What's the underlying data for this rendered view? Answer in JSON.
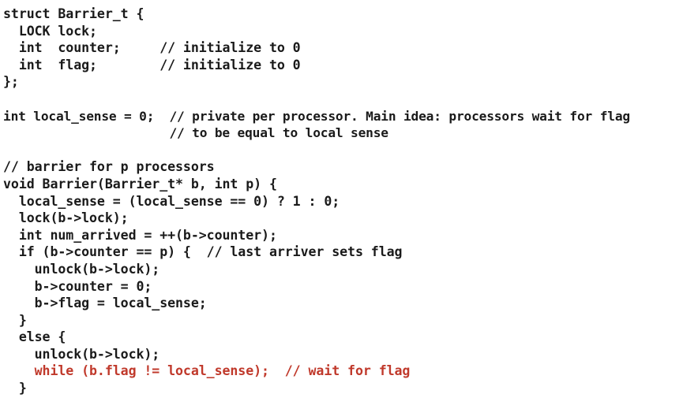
{
  "document": {
    "kind": "source-code-listing",
    "language": "C",
    "background_color": "#ffffff",
    "text_color": "#1a1a1a",
    "highlight_color": "#c0392b"
  },
  "code": {
    "lines": [
      {
        "id": "line-1",
        "text": "struct Barrier_t {",
        "color": "default"
      },
      {
        "id": "line-2",
        "text": "  LOCK lock;",
        "color": "default"
      },
      {
        "id": "line-3",
        "text": "  int  counter;     // initialize to 0",
        "color": "default"
      },
      {
        "id": "line-4",
        "text": "  int  flag;        // initialize to 0",
        "color": "default"
      },
      {
        "id": "line-5",
        "text": "};",
        "color": "default"
      },
      {
        "id": "line-6",
        "text": "",
        "color": "default"
      },
      {
        "id": "line-7",
        "text": "int local_sense = 0;  // private per processor. Main idea: processors wait for flag",
        "color": "default",
        "condensed": true
      },
      {
        "id": "line-8",
        "text": "                      // to be equal to local sense",
        "color": "default",
        "condensed": true
      },
      {
        "id": "line-9",
        "text": "",
        "color": "default"
      },
      {
        "id": "line-10",
        "text": "// barrier for p processors",
        "color": "default"
      },
      {
        "id": "line-11",
        "text": "void Barrier(Barrier_t* b, int p) {",
        "color": "default"
      },
      {
        "id": "line-12",
        "text": "  local_sense = (local_sense == 0) ? 1 : 0;",
        "color": "default"
      },
      {
        "id": "line-13",
        "text": "  lock(b->lock);",
        "color": "default"
      },
      {
        "id": "line-14",
        "text": "  int num_arrived = ++(b->counter);",
        "color": "default"
      },
      {
        "id": "line-15",
        "text": "  if (b->counter == p) {  // last arriver sets flag",
        "color": "default"
      },
      {
        "id": "line-16",
        "text": "    unlock(b->lock);",
        "color": "default"
      },
      {
        "id": "line-17",
        "text": "    b->counter = 0;",
        "color": "default"
      },
      {
        "id": "line-18",
        "text": "    b->flag = local_sense;",
        "color": "default"
      },
      {
        "id": "line-19",
        "text": "  }",
        "color": "default"
      },
      {
        "id": "line-20",
        "text": "  else {",
        "color": "default"
      },
      {
        "id": "line-21",
        "text": "    unlock(b->lock);",
        "color": "default"
      },
      {
        "id": "line-22",
        "text": "    while (b.flag != local_sense);  // wait for flag",
        "color": "highlight"
      },
      {
        "id": "line-23",
        "text": "  }",
        "color": "default"
      }
    ]
  }
}
